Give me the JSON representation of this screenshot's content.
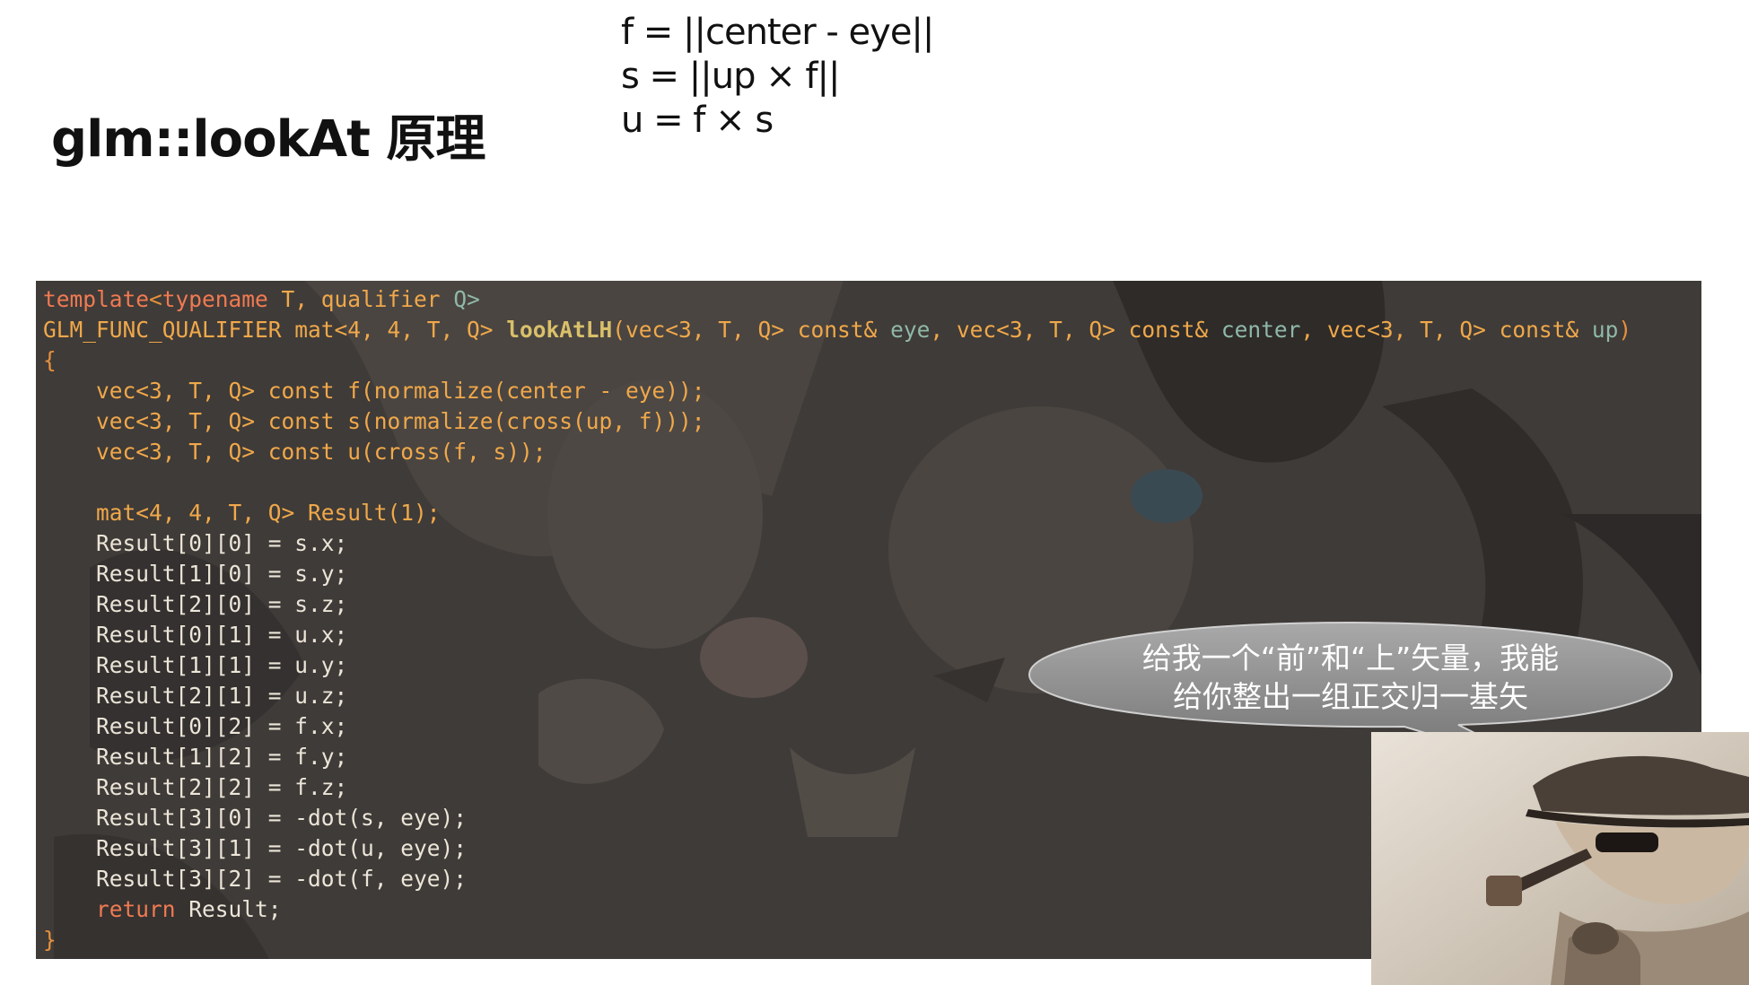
{
  "title": "glm::lookAt  原理",
  "formulas": [
    "f = ||center - eye||",
    "s = ||up × f||",
    "u = f × s"
  ],
  "code": {
    "l1_template": "template",
    "l1_typename": "typename",
    "l1_rest": " T, qualifier ",
    "l1_q": "Q>",
    "l2_macro": "GLM_FUNC_QUALIFIER",
    "l2_sig": " mat<4, 4, T, Q> ",
    "l2_fn": "lookAtLH",
    "l2_args": "(vec<3, T, Q> const& ",
    "l2_eye": "eye",
    "l2_args2": ", vec<3, T, Q> const& ",
    "l2_center": "center",
    "l2_args3": ", vec<3, T, Q> const& ",
    "l2_up": "up",
    "l2_close": ")",
    "open_brace": "{",
    "close_brace": "}",
    "f_line": "    vec<3, T, Q> const f(normalize(center - eye));",
    "s_line": "    vec<3, T, Q> const s(normalize(cross(up, f)));",
    "u_line": "    vec<3, T, Q> const u(cross(f, s));",
    "result_decl": "    mat<4, 4, T, Q> Result(1);",
    "assignments": [
      "    Result[0][0] = s.x;",
      "    Result[1][0] = s.y;",
      "    Result[2][0] = s.z;",
      "    Result[0][1] = u.x;",
      "    Result[1][1] = u.y;",
      "    Result[2][1] = u.z;",
      "    Result[0][2] = f.x;",
      "    Result[1][2] = f.y;",
      "    Result[2][2] = f.z;",
      "    Result[3][0] = -dot(s, eye);",
      "    Result[3][1] = -dot(u, eye);",
      "    Result[3][2] = -dot(f, eye);"
    ],
    "return_kw": "return",
    "return_rest": " Result;"
  },
  "bubble": {
    "line1": "给我一个“前”和“上”矢量，我能",
    "line2": "给你整出一组正交归一基矢"
  },
  "colors": {
    "code_bg": "#3f3b38",
    "keyword": "#f07a52",
    "type": "#f0a84a",
    "bubble": "#8f8f8f"
  }
}
